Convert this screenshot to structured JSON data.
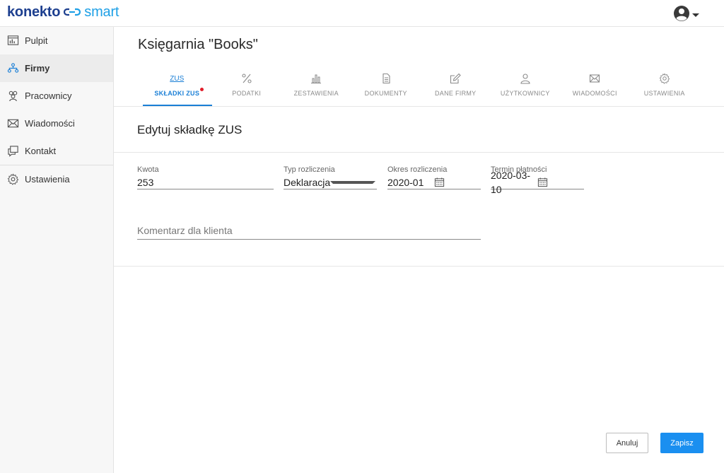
{
  "app": {
    "logo_main": "konekto",
    "logo_accent": "smart"
  },
  "sidebar": {
    "items": [
      {
        "label": "Pulpit",
        "icon": "dashboard-icon"
      },
      {
        "label": "Firmy",
        "icon": "companies-icon",
        "active": true
      },
      {
        "label": "Pracownicy",
        "icon": "employees-icon"
      },
      {
        "label": "Wiadomości",
        "icon": "envelope-icon"
      },
      {
        "label": "Kontakt",
        "icon": "chat-icon"
      },
      {
        "label": "Ustawienia",
        "icon": "gear-icon"
      }
    ]
  },
  "page": {
    "company_title": "Księgarnia \"Books\""
  },
  "tabs": [
    {
      "label": "SKŁADKI ZUS",
      "icon_text": "ZUS",
      "active": true,
      "notification": true
    },
    {
      "label": "PODATKI",
      "icon": "percent-icon"
    },
    {
      "label": "ZESTAWIENIA",
      "icon": "bar-chart-icon"
    },
    {
      "label": "DOKUMENTY",
      "icon": "document-icon"
    },
    {
      "label": "DANE FIRMY",
      "icon": "edit-icon"
    },
    {
      "label": "UŻYTKOWNICY",
      "icon": "user-icon"
    },
    {
      "label": "WIADOMOŚCI",
      "icon": "envelope-icon"
    },
    {
      "label": "USTAWIENIA",
      "icon": "gear-icon"
    }
  ],
  "form": {
    "title": "Edytuj składkę ZUS",
    "kwota": {
      "label": "Kwota",
      "value": "253"
    },
    "typ": {
      "label": "Typ rozliczenia",
      "value": "Deklaracja"
    },
    "okres": {
      "label": "Okres rozliczenia",
      "value": "2020-01"
    },
    "termin": {
      "label": "Termin płatności",
      "value": "2020-03-10"
    },
    "komentarz": {
      "placeholder": "Komentarz dla klienta"
    }
  },
  "buttons": {
    "cancel": "Anuluj",
    "save": "Zapisz"
  },
  "colors": {
    "brand_dark": "#1d3f8f",
    "brand_accent": "#1ea0e6",
    "primary": "#1a8ff0",
    "notification": "#e11d2a"
  }
}
